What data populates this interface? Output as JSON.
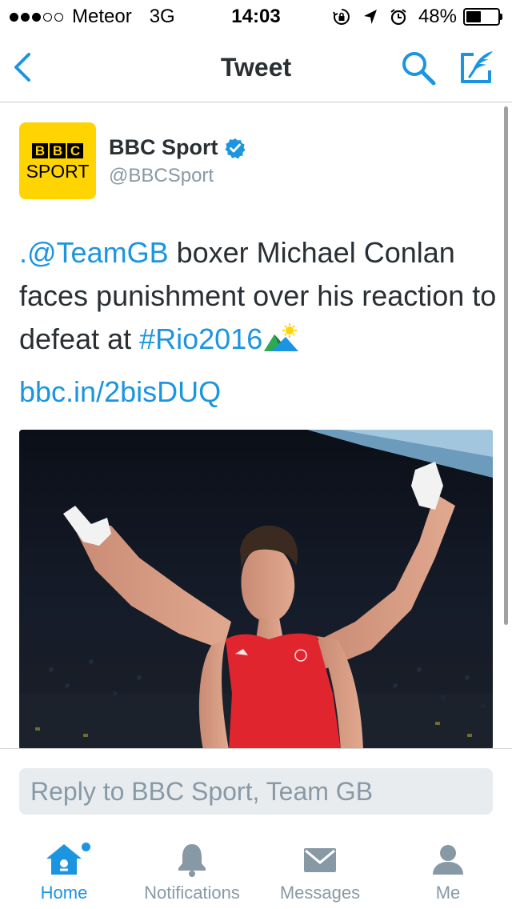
{
  "status_bar": {
    "signal_dots_filled": 3,
    "signal_dots_total": 5,
    "carrier": "Meteor",
    "network": "3G",
    "time": "14:03",
    "battery": "48%",
    "battery_level": 0.48
  },
  "nav": {
    "title": "Tweet",
    "icons": [
      "back-chevron-icon",
      "search-icon",
      "compose-tweet-icon"
    ]
  },
  "tweet": {
    "author": {
      "display_name": "BBC Sport",
      "handle": "@BBCSport",
      "verified": true,
      "avatar_logo": {
        "letters": [
          "B",
          "B",
          "C"
        ],
        "word": "SPORT"
      }
    },
    "text": {
      "mention": ".@TeamGB",
      "part1": " boxer Michael Conlan faces punishment over his reaction to defeat at ",
      "hashtag": "#Rio2016"
    },
    "url": "bbc.in/2bisDUQ"
  },
  "reply": {
    "placeholder": "Reply to BBC Sport, Team GB"
  },
  "tabs": [
    {
      "label": "Home",
      "icon": "home-icon",
      "active": true
    },
    {
      "label": "Notifications",
      "icon": "bell-icon",
      "active": false
    },
    {
      "label": "Messages",
      "icon": "envelope-icon",
      "active": false
    },
    {
      "label": "Me",
      "icon": "person-icon",
      "active": false
    }
  ],
  "colors": {
    "accent": "#1b95e0",
    "muted": "#8899a6",
    "bbc_yellow": "#ffd400",
    "vest_red": "#e0252e"
  }
}
